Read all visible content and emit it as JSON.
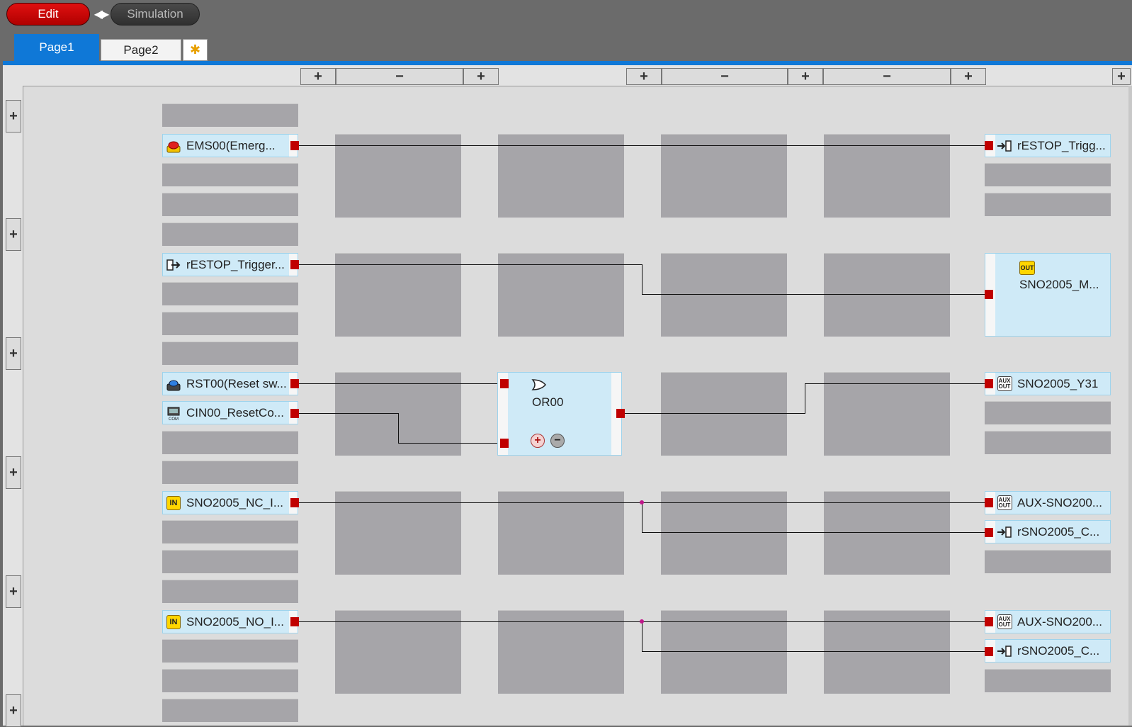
{
  "toolbar": {
    "edit_label": "Edit",
    "simulation_label": "Simulation"
  },
  "tabs": {
    "page1": "Page1",
    "page2": "Page2",
    "new_tab": "✱"
  },
  "controls": {
    "plus": "+",
    "minus": "−"
  },
  "inputs": {
    "ems00": "EMS00(Emerg...",
    "restop_trigger": "rESTOP_Trigger...",
    "rst00": "RST00(Reset sw...",
    "cin00": "CIN00_ResetCo...",
    "sno_nc": "SNO2005_NC_I...",
    "sno_no": "SNO2005_NO_I..."
  },
  "function_blocks": {
    "or00": "OR00"
  },
  "outputs": {
    "restop_trigg": "rESTOP_Trigg...",
    "sno_m": "SNO2005_M...",
    "sno_y31": "SNO2005_Y31",
    "aux_sno_1": "AUX-SNO200...",
    "rsno_c_1": "rSNO2005_C...",
    "aux_sno_2": "AUX-SNO200...",
    "rsno_c_2": "rSNO2005_C..."
  },
  "badges": {
    "in": "IN",
    "out": "OUT",
    "aux": "AUX",
    "aux_out": "OUT",
    "com": "COM"
  },
  "colors": {
    "accent_blue": "#0f78d7",
    "edit_red": "#d40000",
    "pin_red": "#c00000",
    "block_fill": "#cfeaf7",
    "slot_gray": "#a6a5a9",
    "junction_magenta": "#c0168a"
  }
}
